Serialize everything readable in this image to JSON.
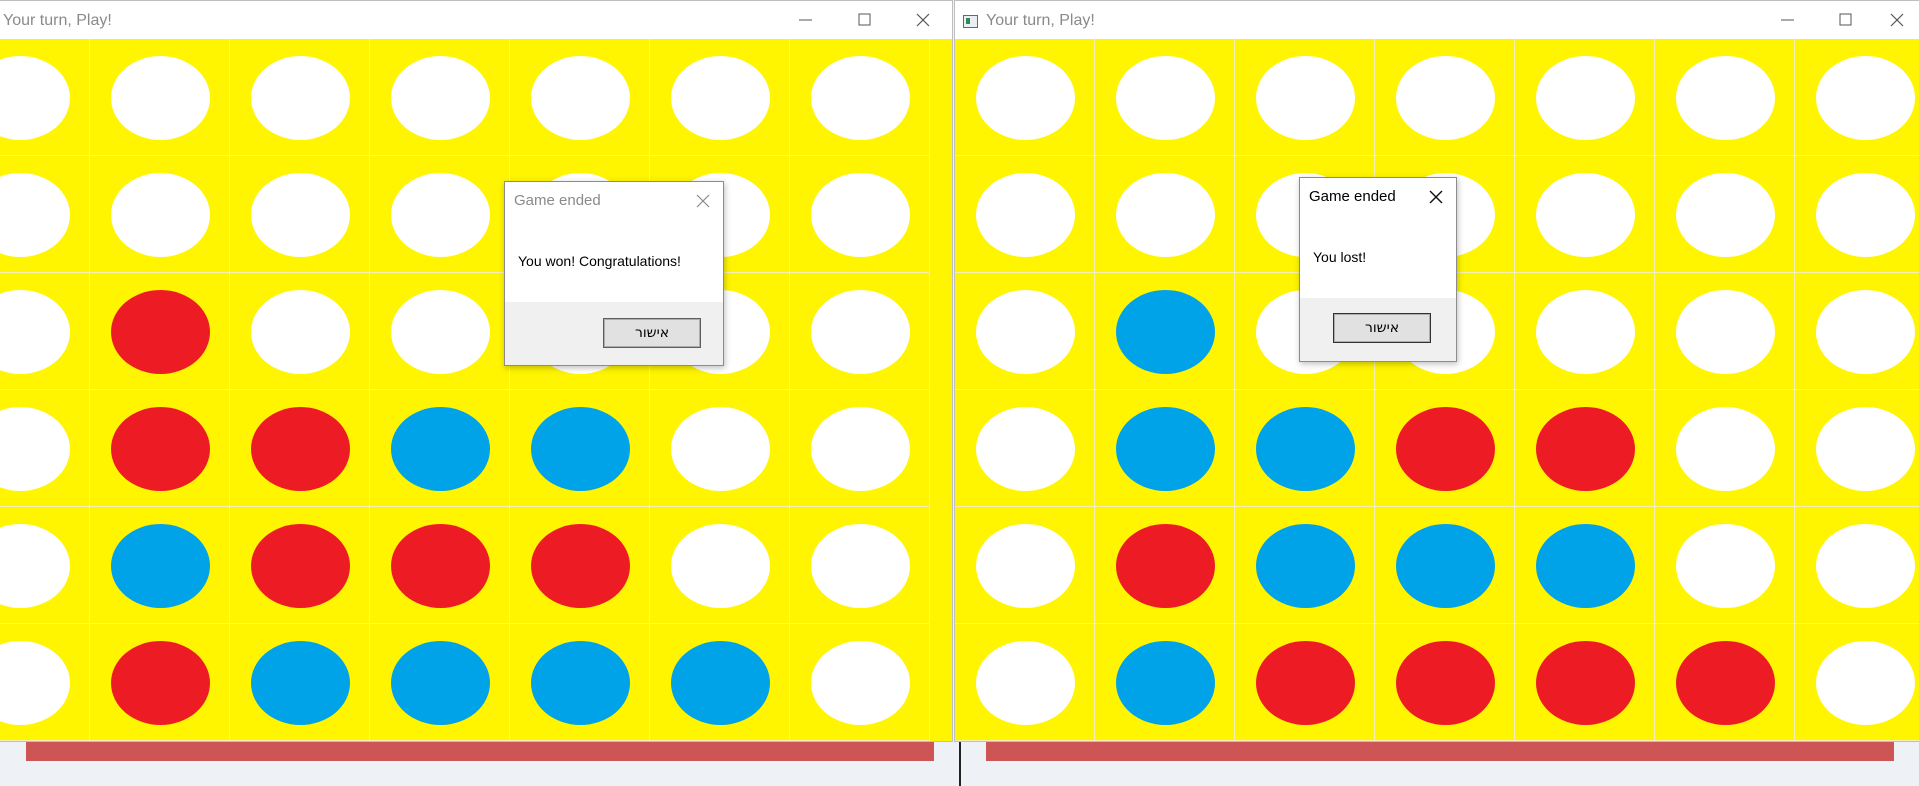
{
  "colors": {
    "board": "#fff500",
    "white": "#ffffff",
    "red": "#ed1c24",
    "blue": "#00a2e8",
    "strip": "#cd5555"
  },
  "windows": [
    {
      "title": "Your turn, Play!",
      "has_app_icon": false,
      "board": [
        [
          "white",
          "white",
          "white",
          "white",
          "white",
          "white",
          "white"
        ],
        [
          "white",
          "white",
          "white",
          "white",
          "white",
          "white",
          "white"
        ],
        [
          "white",
          "red",
          "white",
          "white",
          "white",
          "white",
          "white"
        ],
        [
          "white",
          "red",
          "red",
          "blue",
          "blue",
          "white",
          "white"
        ],
        [
          "white",
          "blue",
          "red",
          "red",
          "red",
          "white",
          "white"
        ],
        [
          "white",
          "red",
          "blue",
          "blue",
          "blue",
          "blue",
          "white"
        ]
      ],
      "dialog": {
        "title": "Game ended",
        "message": "You won! Congratulations!",
        "ok_label": "אישור",
        "active": false
      }
    },
    {
      "title": "Your turn, Play!",
      "has_app_icon": true,
      "board": [
        [
          "white",
          "white",
          "white",
          "white",
          "white",
          "white",
          "white"
        ],
        [
          "white",
          "white",
          "white",
          "white",
          "white",
          "white",
          "white"
        ],
        [
          "white",
          "blue",
          "white",
          "white",
          "white",
          "white",
          "white"
        ],
        [
          "white",
          "blue",
          "blue",
          "red",
          "red",
          "white",
          "white"
        ],
        [
          "white",
          "red",
          "blue",
          "blue",
          "blue",
          "white",
          "white"
        ],
        [
          "white",
          "blue",
          "red",
          "red",
          "red",
          "red",
          "white"
        ]
      ],
      "dialog": {
        "title": "Game ended",
        "message": "You lost!",
        "ok_label": "אישור",
        "active": true
      }
    }
  ]
}
